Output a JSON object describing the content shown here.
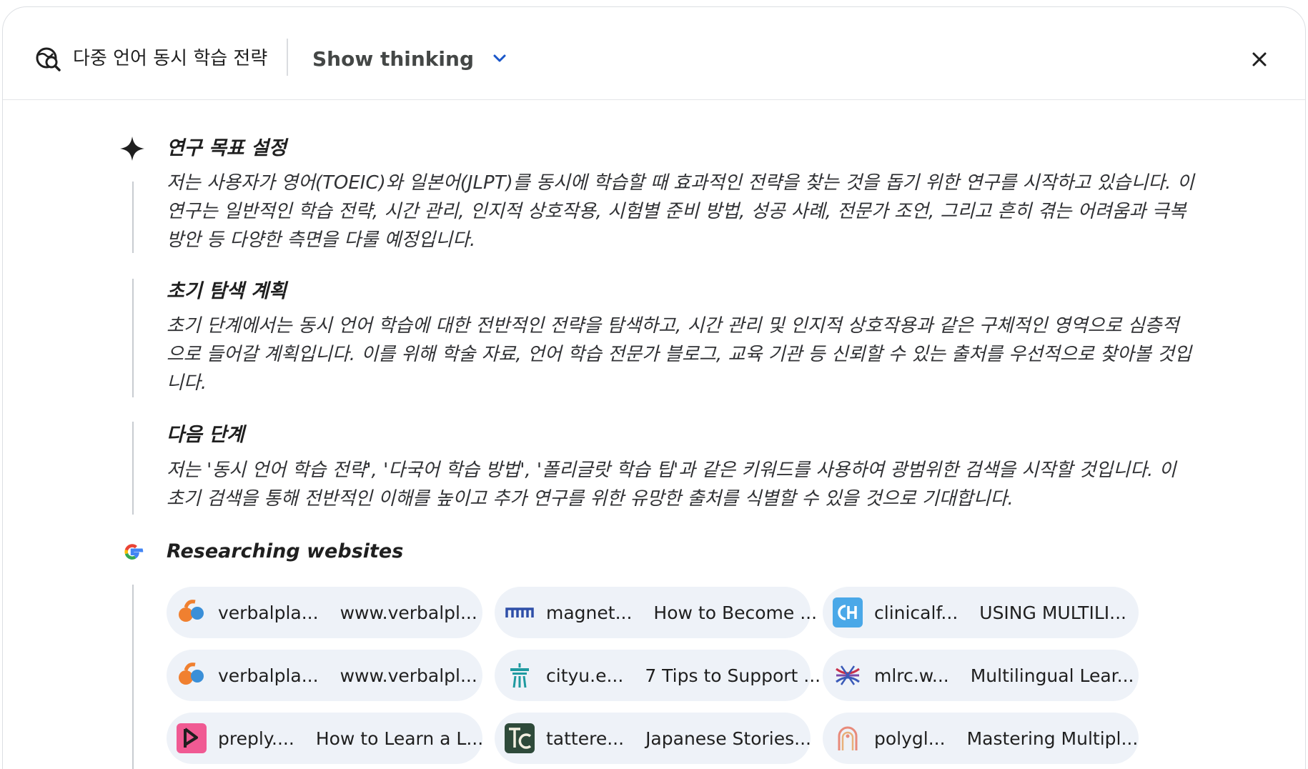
{
  "header": {
    "title": "다중 언어 동시 학습 전략",
    "show_thinking_label": "Show thinking"
  },
  "sections": [
    {
      "title": "연구 목표 설정",
      "body": "저는 사용자가 영어(TOEIC)와 일본어(JLPT)를 동시에 학습할 때 효과적인 전략을 찾는 것을 돕기 위한 연구를 시작하고 있습니다. 이 연구는 일반적인 학습 전략, 시간 관리, 인지적 상호작용, 시험별 준비 방법, 성공 사례, 전문가 조언, 그리고 흔히 겪는 어려움과 극복 방안 등 다양한 측면을 다룰 예정입니다."
    },
    {
      "title": "초기 탐색 계획",
      "body": "초기 단계에서는 동시 언어 학습에 대한 전반적인 전략을 탐색하고, 시간 관리 및 인지적 상호작용과 같은 구체적인 영역으로 심층적으로 들어갈 계획입니다. 이를 위해 학술 자료, 언어 학습 전문가 블로그, 교육 기관 등 신뢰할 수 있는 출처를 우선적으로 찾아볼 것입니다."
    },
    {
      "title": "다음 단계",
      "body": "저는 '동시 언어 학습 전략', '다국어 학습 방법', '폴리글랏 학습 팁'과 같은 키워드를 사용하여 광범위한 검색을 시작할 것입니다. 이 초기 검색을 통해 전반적인 이해를 높이고 추가 연구를 위한 유망한 출처를 식별할 수 있을 것으로 기대합니다."
    }
  ],
  "research": {
    "title": "Researching websites",
    "sources": [
      {
        "site": "verbalpla...",
        "title": "www.verbalpl...",
        "icon": "verbalplanet-icon"
      },
      {
        "site": "magnet...",
        "title": "How to Become ...",
        "icon": "magnet-icon"
      },
      {
        "site": "clinicalf...",
        "title": "USING MULTILI...",
        "icon": "clinicalforum-icon"
      },
      {
        "site": "verbalpla...",
        "title": "www.verbalpl...",
        "icon": "verbalplanet-icon"
      },
      {
        "site": "cityu.e...",
        "title": "7 Tips to Support ...",
        "icon": "cityu-icon"
      },
      {
        "site": "mlrc.w...",
        "title": "Multilingual Lear...",
        "icon": "mlrc-icon"
      },
      {
        "site": "preply....",
        "title": "How to Learn a L...",
        "icon": "preply-icon"
      },
      {
        "site": "tattere...",
        "title": "Japanese Stories...",
        "icon": "tattered-icon"
      },
      {
        "site": "polygl...",
        "title": "Mastering Multipl...",
        "icon": "polyglot-icon"
      }
    ]
  },
  "colors": {
    "chip_bg": "#eef2f8",
    "timeline": "#c8ccd1",
    "preply": "#f05a93",
    "verbalplanet_orange": "#f08030",
    "verbalplanet_blue": "#3a8fd8",
    "magnet_blue": "#2f4fa8",
    "cityu_teal": "#1f9aa0",
    "tattered_green": "#2e4a3a",
    "mlrc": "#c8304a",
    "clinical": "#4aa8e8",
    "polyglot": "#e88a7a"
  }
}
